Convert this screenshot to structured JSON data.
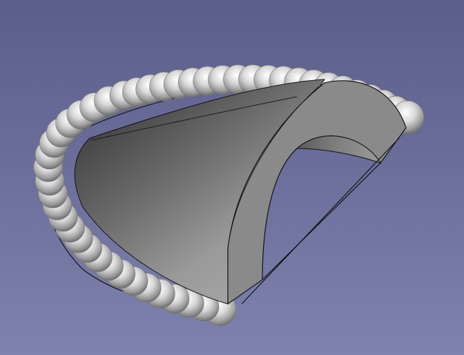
{
  "viewport": {
    "background_top": "#5b5d8a",
    "background_bottom": "#7e82ad"
  },
  "model": {
    "face_light": "#d0d0d0",
    "face_mid": "#9a9a9a",
    "face_dark": "#4a4a4a",
    "edge_color": "#111111",
    "bead_highlight": "#ffffff",
    "bead_shadow": "#6f6f6f"
  },
  "icons": [
    "cad-model-icon"
  ]
}
